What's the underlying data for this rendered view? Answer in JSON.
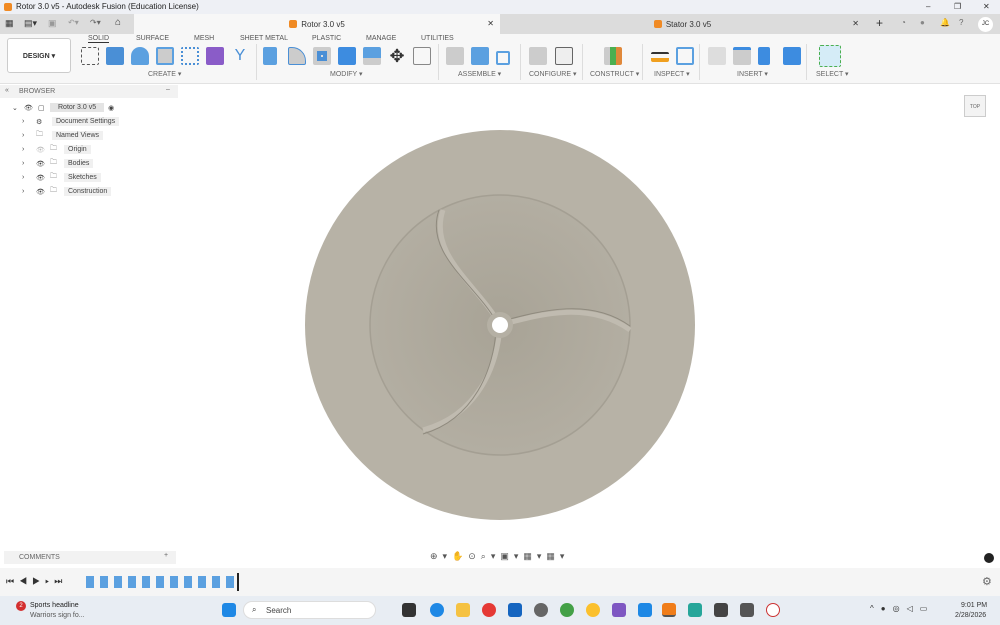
{
  "window": {
    "title": "Rotor 3.0 v5 - Autodesk Fusion (Education License)",
    "minimize": "–",
    "maximize": "❐",
    "close": "✕"
  },
  "tabs": [
    {
      "label": "Rotor 3.0 v5",
      "close": "✕"
    },
    {
      "label": "Stator 3.0 v5",
      "close": "✕"
    }
  ],
  "user_initials": "JC",
  "workspace": "DESIGN ▾",
  "ribbon_tabs": [
    "SOLID",
    "SURFACE",
    "MESH",
    "SHEET METAL",
    "PLASTIC",
    "MANAGE",
    "UTILITIES"
  ],
  "groups": [
    "CREATE ▾",
    "MODIFY ▾",
    "ASSEMBLE ▾",
    "CONFIGURE ▾",
    "CONSTRUCT ▾",
    "INSPECT ▾",
    "INSERT ▾",
    "SELECT ▾"
  ],
  "browser": {
    "title": "BROWSER",
    "collapse": "–",
    "root": "Rotor 3.0 v5",
    "items": [
      "Document Settings",
      "Named Views",
      "Origin",
      "Bodies",
      "Sketches",
      "Construction"
    ]
  },
  "comments": {
    "title": "COMMENTS",
    "add": "+"
  },
  "viewcube": "TOP",
  "taskbar": {
    "news_title": "Sports headline",
    "news_sub": "Warriors sign fo...",
    "badge": "2",
    "search": "Search",
    "time": "9:01 PM",
    "date": "2/28/2026"
  }
}
